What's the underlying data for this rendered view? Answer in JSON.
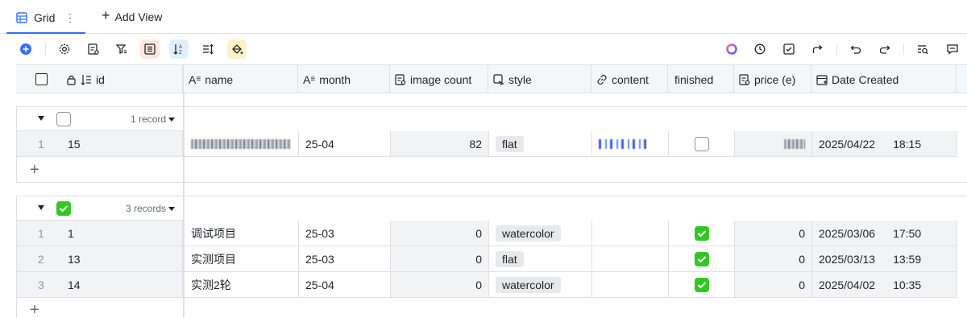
{
  "tabs": {
    "active_label": "Grid",
    "add_view_label": "Add View"
  },
  "columns": [
    {
      "label": "id",
      "icon": "lock-sort-icon"
    },
    {
      "label": "name",
      "icon": "text-field-icon"
    },
    {
      "label": "month",
      "icon": "text-field-icon"
    },
    {
      "label": "image count",
      "icon": "formula-field-icon"
    },
    {
      "label": "style",
      "icon": "select-field-icon"
    },
    {
      "label": "content",
      "icon": "link-field-icon"
    },
    {
      "label": "finished",
      "icon": ""
    },
    {
      "label": "price (e)",
      "icon": "formula-field-icon"
    },
    {
      "label": "Date Created",
      "icon": "created-date-icon"
    }
  ],
  "groups": [
    {
      "checked": false,
      "count_label": "1 record",
      "rows": [
        {
          "index": "1",
          "id": "15",
          "name": "",
          "month": "25-04",
          "image_count": "82",
          "style": "flat",
          "content": "",
          "finished": false,
          "price": "",
          "date": "2025/04/22",
          "time": "18:15"
        }
      ]
    },
    {
      "checked": true,
      "count_label": "3 records",
      "rows": [
        {
          "index": "1",
          "id": "1",
          "name": "调试项目",
          "month": "25-03",
          "image_count": "0",
          "style": "watercolor",
          "content": "",
          "finished": true,
          "price": "0",
          "date": "2025/03/06",
          "time": "17:50"
        },
        {
          "index": "2",
          "id": "13",
          "name": "实测项目",
          "month": "25-03",
          "image_count": "0",
          "style": "flat",
          "content": "",
          "finished": true,
          "price": "0",
          "date": "2025/03/13",
          "time": "13:59"
        },
        {
          "index": "3",
          "id": "14",
          "name": "实测2轮",
          "month": "25-04",
          "image_count": "0",
          "style": "watercolor",
          "content": "",
          "finished": true,
          "price": "0",
          "date": "2025/04/02",
          "time": "10:35"
        }
      ]
    }
  ],
  "colors": {
    "accent": "#3370ff",
    "checked_green": "#34c724",
    "sort_highlight": "#e1f0fb",
    "group_highlight": "#fde7dc",
    "fill_highlight": "#fdf1c6"
  }
}
